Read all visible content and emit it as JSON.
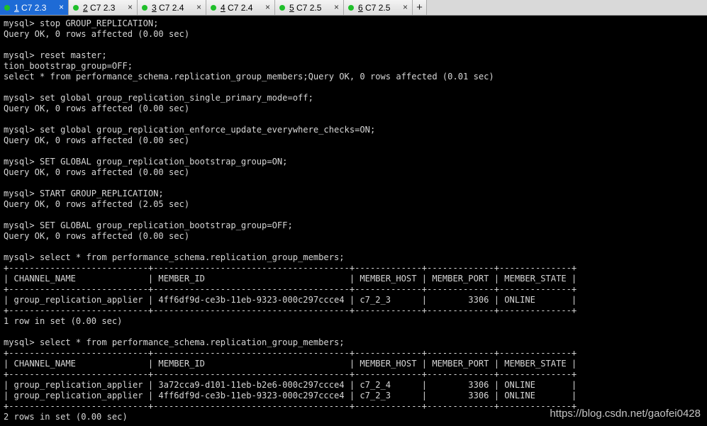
{
  "tabs": [
    {
      "num": "1",
      "label": "C7 2.3",
      "active": true,
      "status": "connected",
      "close": "×"
    },
    {
      "num": "2",
      "label": "C7 2.3",
      "active": false,
      "status": "connected",
      "close": "×"
    },
    {
      "num": "3",
      "label": "C7 2.4",
      "active": false,
      "status": "connected",
      "close": "×"
    },
    {
      "num": "4",
      "label": "C7 2.4",
      "active": false,
      "status": "connected",
      "close": "×"
    },
    {
      "num": "5",
      "label": "C7 2.5",
      "active": false,
      "status": "connected",
      "close": "×"
    },
    {
      "num": "6",
      "label": "C7 2.5",
      "active": false,
      "status": "connected",
      "close": "×"
    }
  ],
  "new_tab_label": "+",
  "colors": {
    "background": "#000000",
    "text": "#d6d6d6",
    "active_tab": "#1e6bd6",
    "status_dot": "#1fbf2a"
  },
  "terminal": {
    "lines": [
      "mysql> stop GROUP_REPLICATION;",
      "Query OK, 0 rows affected (0.00 sec)",
      "",
      "mysql> reset master;",
      "tion_bootstrap_group=OFF;",
      "select * from performance_schema.replication_group_members;Query OK, 0 rows affected (0.01 sec)",
      "",
      "mysql> set global group_replication_single_primary_mode=off;",
      "Query OK, 0 rows affected (0.00 sec)",
      "",
      "mysql> set global group_replication_enforce_update_everywhere_checks=ON;",
      "Query OK, 0 rows affected (0.00 sec)",
      "",
      "mysql> SET GLOBAL group_replication_bootstrap_group=ON;",
      "Query OK, 0 rows affected (0.00 sec)",
      "",
      "mysql> START GROUP_REPLICATION;",
      "Query OK, 0 rows affected (2.05 sec)",
      "",
      "mysql> SET GLOBAL group_replication_bootstrap_group=OFF;",
      "Query OK, 0 rows affected (0.00 sec)",
      "",
      "mysql> select * from performance_schema.replication_group_members;",
      "+---------------------------+--------------------------------------+-------------+-------------+--------------+",
      "| CHANNEL_NAME              | MEMBER_ID                            | MEMBER_HOST | MEMBER_PORT | MEMBER_STATE |",
      "+---------------------------+--------------------------------------+-------------+-------------+--------------+",
      "| group_replication_applier | 4ff6df9d-ce3b-11eb-9323-000c297ccce4 | c7_2_3      |        3306 | ONLINE       |",
      "+---------------------------+--------------------------------------+-------------+-------------+--------------+",
      "1 row in set (0.00 sec)",
      "",
      "mysql> select * from performance_schema.replication_group_members;",
      "+---------------------------+--------------------------------------+-------------+-------------+--------------+",
      "| CHANNEL_NAME              | MEMBER_ID                            | MEMBER_HOST | MEMBER_PORT | MEMBER_STATE |",
      "+---------------------------+--------------------------------------+-------------+-------------+--------------+",
      "| group_replication_applier | 3a72cca9-d101-11eb-b2e6-000c297ccce4 | c7_2_4      |        3306 | ONLINE       |",
      "| group_replication_applier | 4ff6df9d-ce3b-11eb-9323-000c297ccce4 | c7_2_3      |        3306 | ONLINE       |",
      "+---------------------------+--------------------------------------+-------------+-------------+--------------+",
      "2 rows in set (0.00 sec)"
    ]
  },
  "watermark": "https://blog.csdn.net/gaofei0428"
}
